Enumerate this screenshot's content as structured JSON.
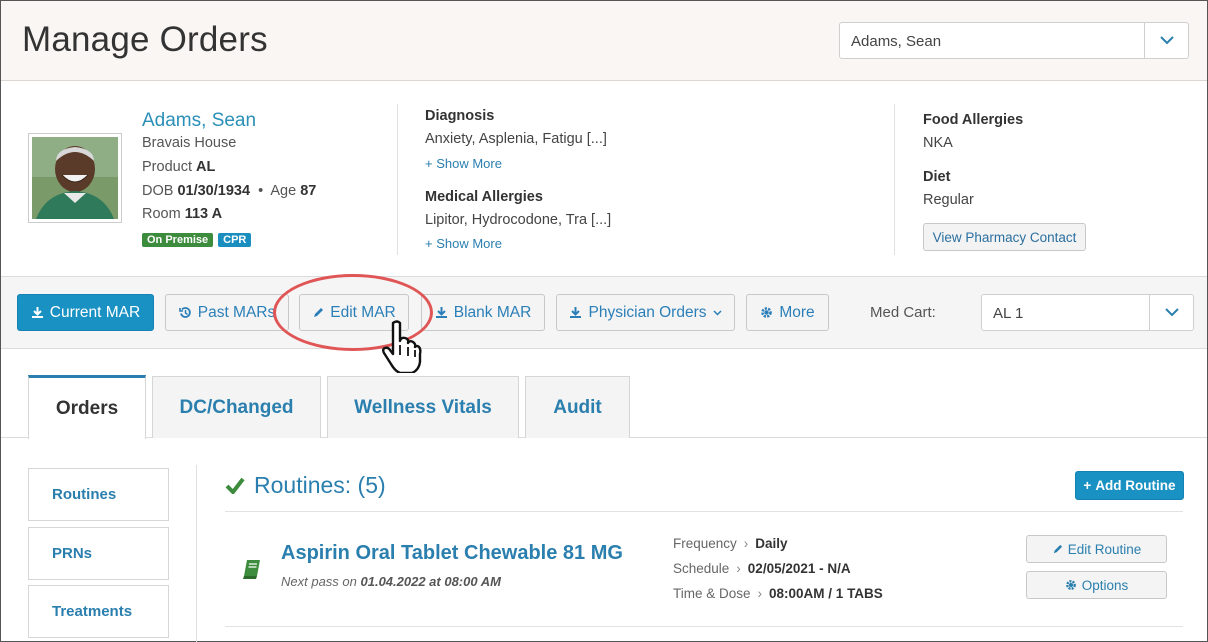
{
  "header": {
    "title": "Manage Orders",
    "resident_select": "Adams, Sean"
  },
  "resident": {
    "name": "Adams, Sean",
    "facility": "Bravais House",
    "product_label": "Product",
    "product": "AL",
    "dob_label": "DOB",
    "dob": "01/30/1934",
    "bullet": "•",
    "age_label": "Age",
    "age": "87",
    "room_label": "Room",
    "room": "113 A",
    "badges": [
      {
        "label": "On Premise",
        "color": "#3d8b3d"
      },
      {
        "label": "CPR",
        "color": "#1a8fbf"
      }
    ]
  },
  "clinical": {
    "diagnosis_label": "Diagnosis",
    "diagnosis": "Anxiety, Asplenia, Fatigu [...]",
    "show_more_1": "Show More",
    "med_allergies_label": "Medical Allergies",
    "med_allergies": "Lipitor, Hydrocodone, Tra [...]",
    "show_more_2": "Show More"
  },
  "food": {
    "allergies_label": "Food Allergies",
    "allergies": "NKA",
    "diet_label": "Diet",
    "diet": "Regular",
    "pharmacy_button": "View Pharmacy Contact"
  },
  "toolbar": {
    "current_mar": "Current MAR",
    "past_mars": "Past MARs",
    "edit_mar": "Edit MAR",
    "blank_mar": "Blank MAR",
    "physician_orders": "Physician Orders",
    "more": "More",
    "med_cart_label": "Med Cart:",
    "med_cart_value": "AL 1"
  },
  "tabs": [
    "Orders",
    "DC/Changed",
    "Wellness Vitals",
    "Audit"
  ],
  "side_nav": [
    "Routines",
    "PRNs",
    "Treatments"
  ],
  "routines": {
    "heading": "Routines: (5)",
    "add_button": "Add Routine",
    "item": {
      "title": "Aspirin Oral Tablet Chewable 81 MG",
      "next_pass_label": "Next pass on",
      "next_pass": "01.04.2022 at 08:00 AM",
      "frequency_label": "Frequency",
      "frequency": "Daily",
      "schedule_label": "Schedule",
      "schedule": "02/05/2021 - N/A",
      "time_dose_label": "Time & Dose",
      "time_dose": "08:00AM / 1 TABS",
      "edit_button": "Edit Routine",
      "options_button": "Options"
    }
  },
  "colors": {
    "accent": "#1a91c3",
    "link": "#2a7fae",
    "annotation": "#e05555",
    "check": "#3d8b3d"
  }
}
